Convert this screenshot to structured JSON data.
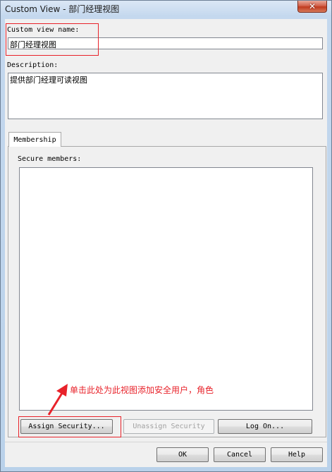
{
  "window": {
    "title": "Custom View - 部门经理视图",
    "close_glyph": "✕"
  },
  "form": {
    "name_label": "Custom view name:",
    "name_value": "部门经理视图",
    "description_label": "Description:",
    "description_value": "提供部门经理可读视图"
  },
  "tabs": [
    {
      "label": "Membership"
    }
  ],
  "membership": {
    "members_label": "Secure members:",
    "members": []
  },
  "annotation": {
    "text": "单击此处为此视图添加安全用户，角色",
    "color": "#e8222a"
  },
  "buttons": {
    "assign": "Assign Security...",
    "unassign": "Unassign Security",
    "logon": "Log On...",
    "ok": "OK",
    "cancel": "Cancel",
    "help": "Help"
  }
}
